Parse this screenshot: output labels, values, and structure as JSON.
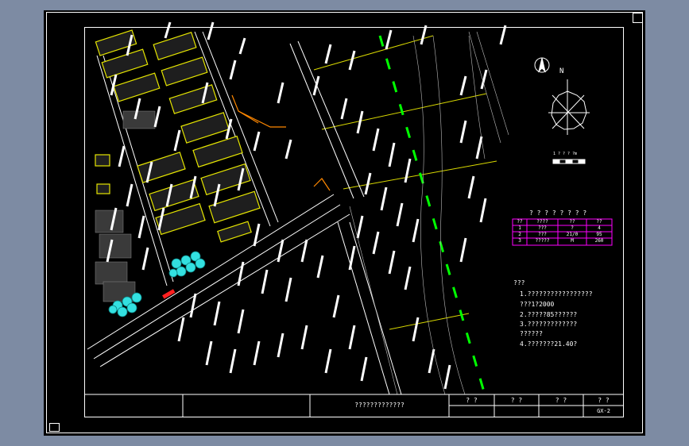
{
  "legend_table": {
    "title": "? ? ? ? ? ? ? ?",
    "headers": [
      "??",
      "????",
      "??",
      "??"
    ],
    "rows": [
      [
        "1",
        "???",
        "?",
        "4"
      ],
      [
        "2",
        "???",
        "21/0",
        "95"
      ],
      [
        "3",
        "?????",
        "M",
        "260"
      ]
    ]
  },
  "notes": {
    "heading": "???",
    "lines": [
      "1.?????????????????",
      "  ???1?2000",
      "2.?????85??????",
      "3.?????????????",
      "  ??????",
      "4.???????21.40?"
    ]
  },
  "north_label": "N",
  "scale_label": "1 ? ? ? ?m",
  "title_block": {
    "main_title": "?????????????",
    "cells": [
      "? ?",
      "? ?",
      "? ?",
      "? ?"
    ],
    "drawing_no": "GX-2"
  },
  "colors": {
    "background": "#7d8ba3",
    "canvas": "#000000",
    "line_white": "#ffffff",
    "road_yellow": "#ffff00",
    "center_green": "#00ff00",
    "table_magenta": "#ff00ff",
    "route_orange": "#ff8800",
    "tree_cyan": "#33e0e0",
    "accent_red": "#ff0000"
  }
}
